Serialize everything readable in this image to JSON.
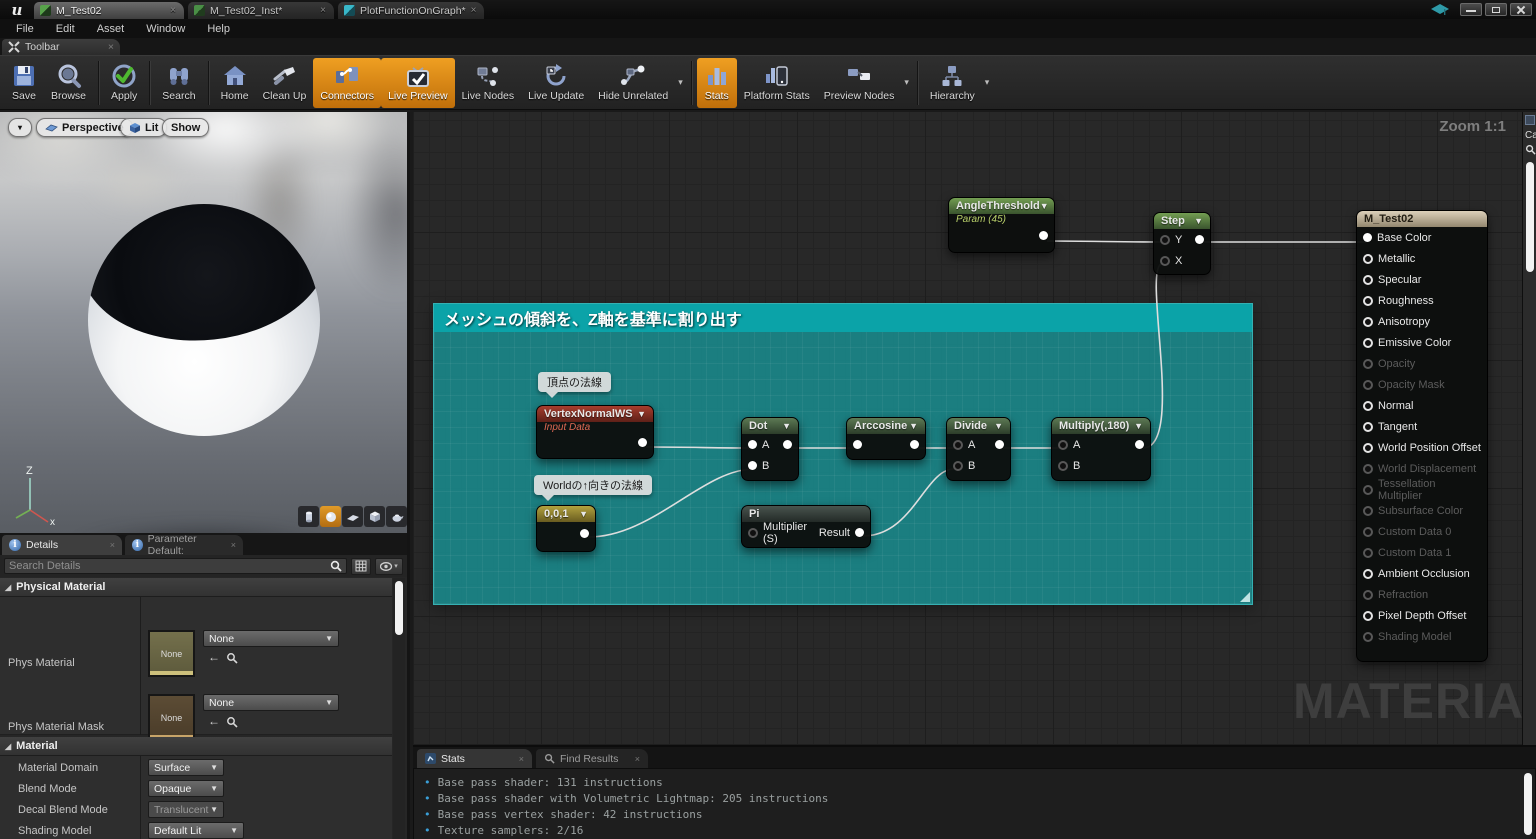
{
  "titlebar": {
    "logo": "u",
    "close_glyph": "×",
    "tabs": [
      {
        "label": "M_Test02"
      },
      {
        "label": "M_Test02_Inst*"
      },
      {
        "label": "PlotFunctionOnGraph*"
      }
    ]
  },
  "menubar": {
    "items": [
      "File",
      "Edit",
      "Asset",
      "Window",
      "Help"
    ]
  },
  "toolbar": {
    "tab_label": "Toolbar",
    "buttons": [
      {
        "label": "Save"
      },
      {
        "label": "Browse"
      },
      {
        "label": "Apply"
      },
      {
        "label": "Search"
      },
      {
        "label": "Home"
      },
      {
        "label": "Clean Up"
      },
      {
        "label": "Connectors",
        "active": true
      },
      {
        "label": "Live Preview",
        "active": true
      },
      {
        "label": "Live Nodes"
      },
      {
        "label": "Live Update"
      },
      {
        "label": "Hide Unrelated",
        "dropdown": true
      },
      {
        "label": "Stats",
        "active": true
      },
      {
        "label": "Platform Stats"
      },
      {
        "label": "Preview Nodes",
        "dropdown": true
      },
      {
        "label": "Hierarchy",
        "dropdown": true
      }
    ]
  },
  "viewport": {
    "buttons": {
      "perspective": "Perspective",
      "lit": "Lit",
      "show": "Show"
    },
    "axis": {
      "z": "Z",
      "x": "x"
    }
  },
  "details": {
    "tabs": [
      {
        "label": "Details"
      },
      {
        "label": "Parameter Default:"
      }
    ],
    "search_placeholder": "Search Details",
    "physical_material": {
      "title": "Physical Material",
      "rows": [
        {
          "label": "Phys Material",
          "thumb": "None",
          "value": "None"
        },
        {
          "label": "Phys Material Mask",
          "thumb": "None",
          "value": "None"
        }
      ]
    },
    "material": {
      "title": "Material",
      "rows": [
        {
          "label": "Material Domain",
          "value": "Surface"
        },
        {
          "label": "Blend Mode",
          "value": "Opaque"
        },
        {
          "label": "Decal Blend Mode",
          "value": "Translucent"
        },
        {
          "label": "Shading Model",
          "value": "Default Lit"
        }
      ]
    }
  },
  "graph": {
    "zoom_label": "Zoom 1:1",
    "watermark": "MATERIAL",
    "comment": {
      "title": "メッシュの傾斜を、Z軸を基準に割り出す"
    },
    "bubbles": [
      {
        "text": "頂点の法線"
      },
      {
        "text": "Worldの↑向きの法線"
      }
    ],
    "nodes": {
      "angle_threshold": {
        "title": "AngleThreshold",
        "subtitle": "Param (45)"
      },
      "step": {
        "title": "Step",
        "pins": [
          "Y",
          "X"
        ]
      },
      "vertex_normal": {
        "title": "VertexNormalWS",
        "subtitle": "Input Data"
      },
      "const_001": {
        "title": "0,0,1"
      },
      "dot": {
        "title": "Dot",
        "pins": [
          "A",
          "B"
        ]
      },
      "arccosine": {
        "title": "Arccosine"
      },
      "divide": {
        "title": "Divide",
        "pins": [
          "A",
          "B"
        ]
      },
      "multiply": {
        "title": "Multiply(,180)",
        "pins": [
          "A",
          "B"
        ]
      },
      "pi": {
        "title": "Pi",
        "input_label": "Multiplier (S)",
        "output_label": "Result"
      },
      "result": {
        "title": "M_Test02",
        "pins": [
          {
            "label": "Base Color",
            "state": "connected"
          },
          {
            "label": "Metallic",
            "state": "active"
          },
          {
            "label": "Specular",
            "state": "active"
          },
          {
            "label": "Roughness",
            "state": "active"
          },
          {
            "label": "Anisotropy",
            "state": "active"
          },
          {
            "label": "Emissive Color",
            "state": "active"
          },
          {
            "label": "Opacity",
            "state": "disabled"
          },
          {
            "label": "Opacity Mask",
            "state": "disabled"
          },
          {
            "label": "Normal",
            "state": "active"
          },
          {
            "label": "Tangent",
            "state": "active"
          },
          {
            "label": "World Position Offset",
            "state": "active"
          },
          {
            "label": "World Displacement",
            "state": "disabled"
          },
          {
            "label": "Tessellation Multiplier",
            "state": "disabled"
          },
          {
            "label": "Subsurface Color",
            "state": "disabled"
          },
          {
            "label": "Custom Data 0",
            "state": "disabled"
          },
          {
            "label": "Custom Data 1",
            "state": "disabled"
          },
          {
            "label": "Ambient Occlusion",
            "state": "active"
          },
          {
            "label": "Refraction",
            "state": "disabled"
          },
          {
            "label": "Pixel Depth Offset",
            "state": "active"
          },
          {
            "label": "Shading Model",
            "state": "disabled"
          }
        ]
      }
    }
  },
  "right_strip": {
    "label": "Ca"
  },
  "stats_panel": {
    "tabs": [
      {
        "label": "Stats"
      },
      {
        "label": "Find Results"
      }
    ],
    "lines": [
      "Base pass shader: 131 instructions",
      "Base pass shader with Volumetric Lightmap: 205 instructions",
      "Base pass vertex shader: 42 instructions",
      "Texture samplers: 2/16"
    ]
  }
}
